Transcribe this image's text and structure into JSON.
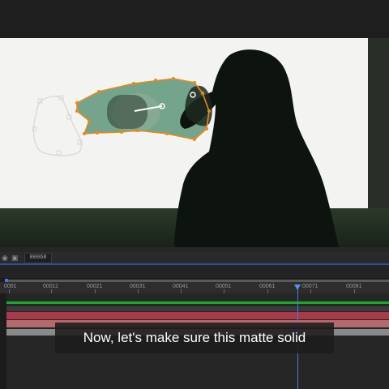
{
  "timeline": {
    "timecode": "00068",
    "ruler_labels": [
      "0001",
      "00011",
      "00021",
      "00031",
      "00041",
      "00051",
      "00061",
      "00071",
      "00081"
    ]
  },
  "subtitle": {
    "text": "Now, let's make sure this matte solid"
  },
  "colors": {
    "mask_path": "#e8891c",
    "track_green": "#1aaa2a",
    "track_red": "#a93a4c",
    "track_salmon": "#b26a6a",
    "playhead": "#4a7fd8"
  },
  "icons": {
    "camera": "camera-icon",
    "snapshot": "snapshot-icon"
  }
}
